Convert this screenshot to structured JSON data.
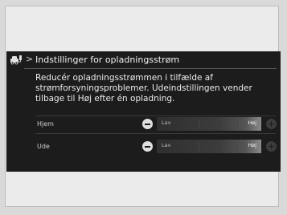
{
  "header": {
    "title": "Indstillinger for opladningsstrøm",
    "back_chevron": ">",
    "icon": "car-charging-icon"
  },
  "description": "Reducér opladningsstrømmen i tilfælde af strømforsyningsproblemer. Udeindstillingen vender tilbage til Høj efter én opladning.",
  "rows": [
    {
      "label": "Hjem",
      "min_label": "Lav",
      "max_label": "Høj",
      "level": 1.0
    },
    {
      "label": "Ude",
      "min_label": "Lav",
      "max_label": "Høj",
      "level": 1.0
    }
  ],
  "colors": {
    "screen_bg": "#1c1c1c",
    "page_bg": "#ebebeb"
  }
}
